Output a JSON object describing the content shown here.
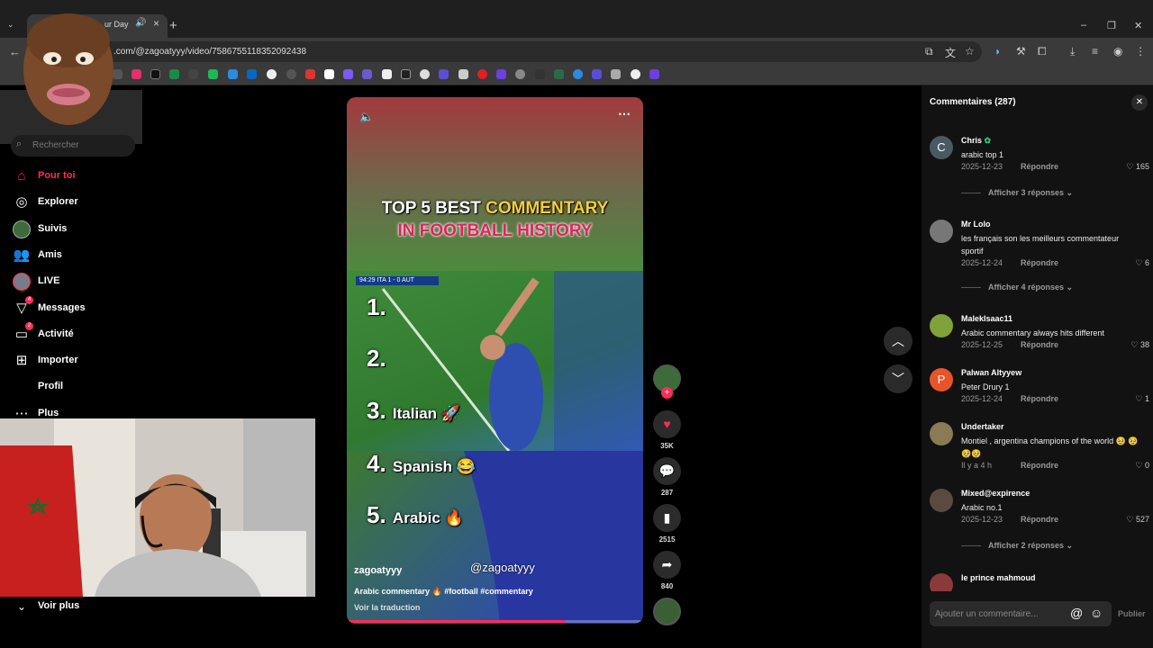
{
  "browser": {
    "tab_title": "ur Day",
    "tab_audio_icon": "speaker-icon",
    "tab_close": "×",
    "new_tab": "+",
    "url": ".com/@zagoatyyy/video/7586755118352092438",
    "window_minimize": "–",
    "window_restore": "❐",
    "window_close": "✕"
  },
  "sidebar": {
    "search_placeholder": "Rechercher",
    "items": [
      {
        "label": "Pour toi",
        "icon": "home-icon",
        "active": true
      },
      {
        "label": "Explorer",
        "icon": "compass-icon"
      },
      {
        "label": "Suivis",
        "icon": "following-avatar-icon"
      },
      {
        "label": "Amis",
        "icon": "friends-icon"
      },
      {
        "label": "LIVE",
        "icon": "live-icon"
      },
      {
        "label": "Messages",
        "icon": "messages-icon",
        "badge": "4"
      },
      {
        "label": "Activité",
        "icon": "activity-icon",
        "badge": "2"
      },
      {
        "label": "Importer",
        "icon": "upload-icon"
      },
      {
        "label": "Profil",
        "icon": "profile-icon"
      },
      {
        "label": "Plus",
        "icon": "more-dots-icon"
      }
    ],
    "see_more": "Voir plus"
  },
  "video": {
    "title_white": "TOP 5 BEST",
    "title_yellow": "COMMENTARY",
    "title_line2": "IN FOOTBALL HISTORY",
    "scorebug": "94:29  ITA  1 - 0  AUT",
    "ranks": [
      {
        "num": "1.",
        "name": ""
      },
      {
        "num": "2.",
        "name": ""
      },
      {
        "num": "3.",
        "name": "Italian 🚀"
      },
      {
        "num": "4.",
        "name": "Spanish 😂"
      },
      {
        "num": "5.",
        "name": "Arabic 🔥"
      }
    ],
    "watermark": "@zagoatyyy",
    "author": "zagoatyyy",
    "caption": "Arabic commentary 🔥 #football #commentary",
    "translate": "Voir la traduction",
    "progress": 0.74
  },
  "actions": {
    "likes": "35K",
    "comments": "287",
    "saves": "2515",
    "shares": "840"
  },
  "comments_panel": {
    "title": "Commentaires",
    "count": "(287)",
    "reply_label": "Répondre",
    "items": [
      {
        "user": "Chris",
        "avatar_letter": "C",
        "avatar_color": "#4a5a63",
        "text": "arabic top 1",
        "date": "2025-12-23",
        "likes": "165",
        "more": "Afficher 3 réponses"
      },
      {
        "user": "Mr Lolo",
        "avatar_letter": "",
        "avatar_color": "#777777",
        "text": "les français son les meilleurs commentateur sportif",
        "date": "2025-12-24",
        "likes": "6",
        "more": "Afficher 4 réponses"
      },
      {
        "user": "MalekIsaac11",
        "avatar_letter": "",
        "avatar_color": "#7fa23a",
        "text": "Arabic commentary always hits different",
        "date": "2025-12-25",
        "likes": "38",
        "more": ""
      },
      {
        "user": "Palwan Altyyew",
        "avatar_letter": "P",
        "avatar_color": "#e8542a",
        "text": "Peter Drury 1",
        "date": "2025-12-24",
        "likes": "1",
        "more": ""
      },
      {
        "user": "Undertaker",
        "avatar_letter": "",
        "avatar_color": "#8a7a55",
        "text": "Montiel , argentina champions of the world 🥹 🥹🥹🥹",
        "date": "Il y a 4 h",
        "likes": "0",
        "more": ""
      },
      {
        "user": "Mixed@expirence",
        "avatar_letter": "",
        "avatar_color": "#5a4a40",
        "text": "Arabic no.1",
        "date": "2025-12-23",
        "likes": "527",
        "more": "Afficher 2 réponses"
      },
      {
        "user": "le prince mahmoud",
        "avatar_letter": "",
        "avatar_color": "#8a3a3a",
        "text": "",
        "date": "",
        "likes": "",
        "more": ""
      }
    ],
    "input_placeholder": "Ajouter un commentaire...",
    "at": "@",
    "post": "Publier"
  },
  "colors": {
    "accent": "#fe2c55",
    "title_yellow": "#f5cf3b",
    "title_pink": "#e0245e"
  }
}
